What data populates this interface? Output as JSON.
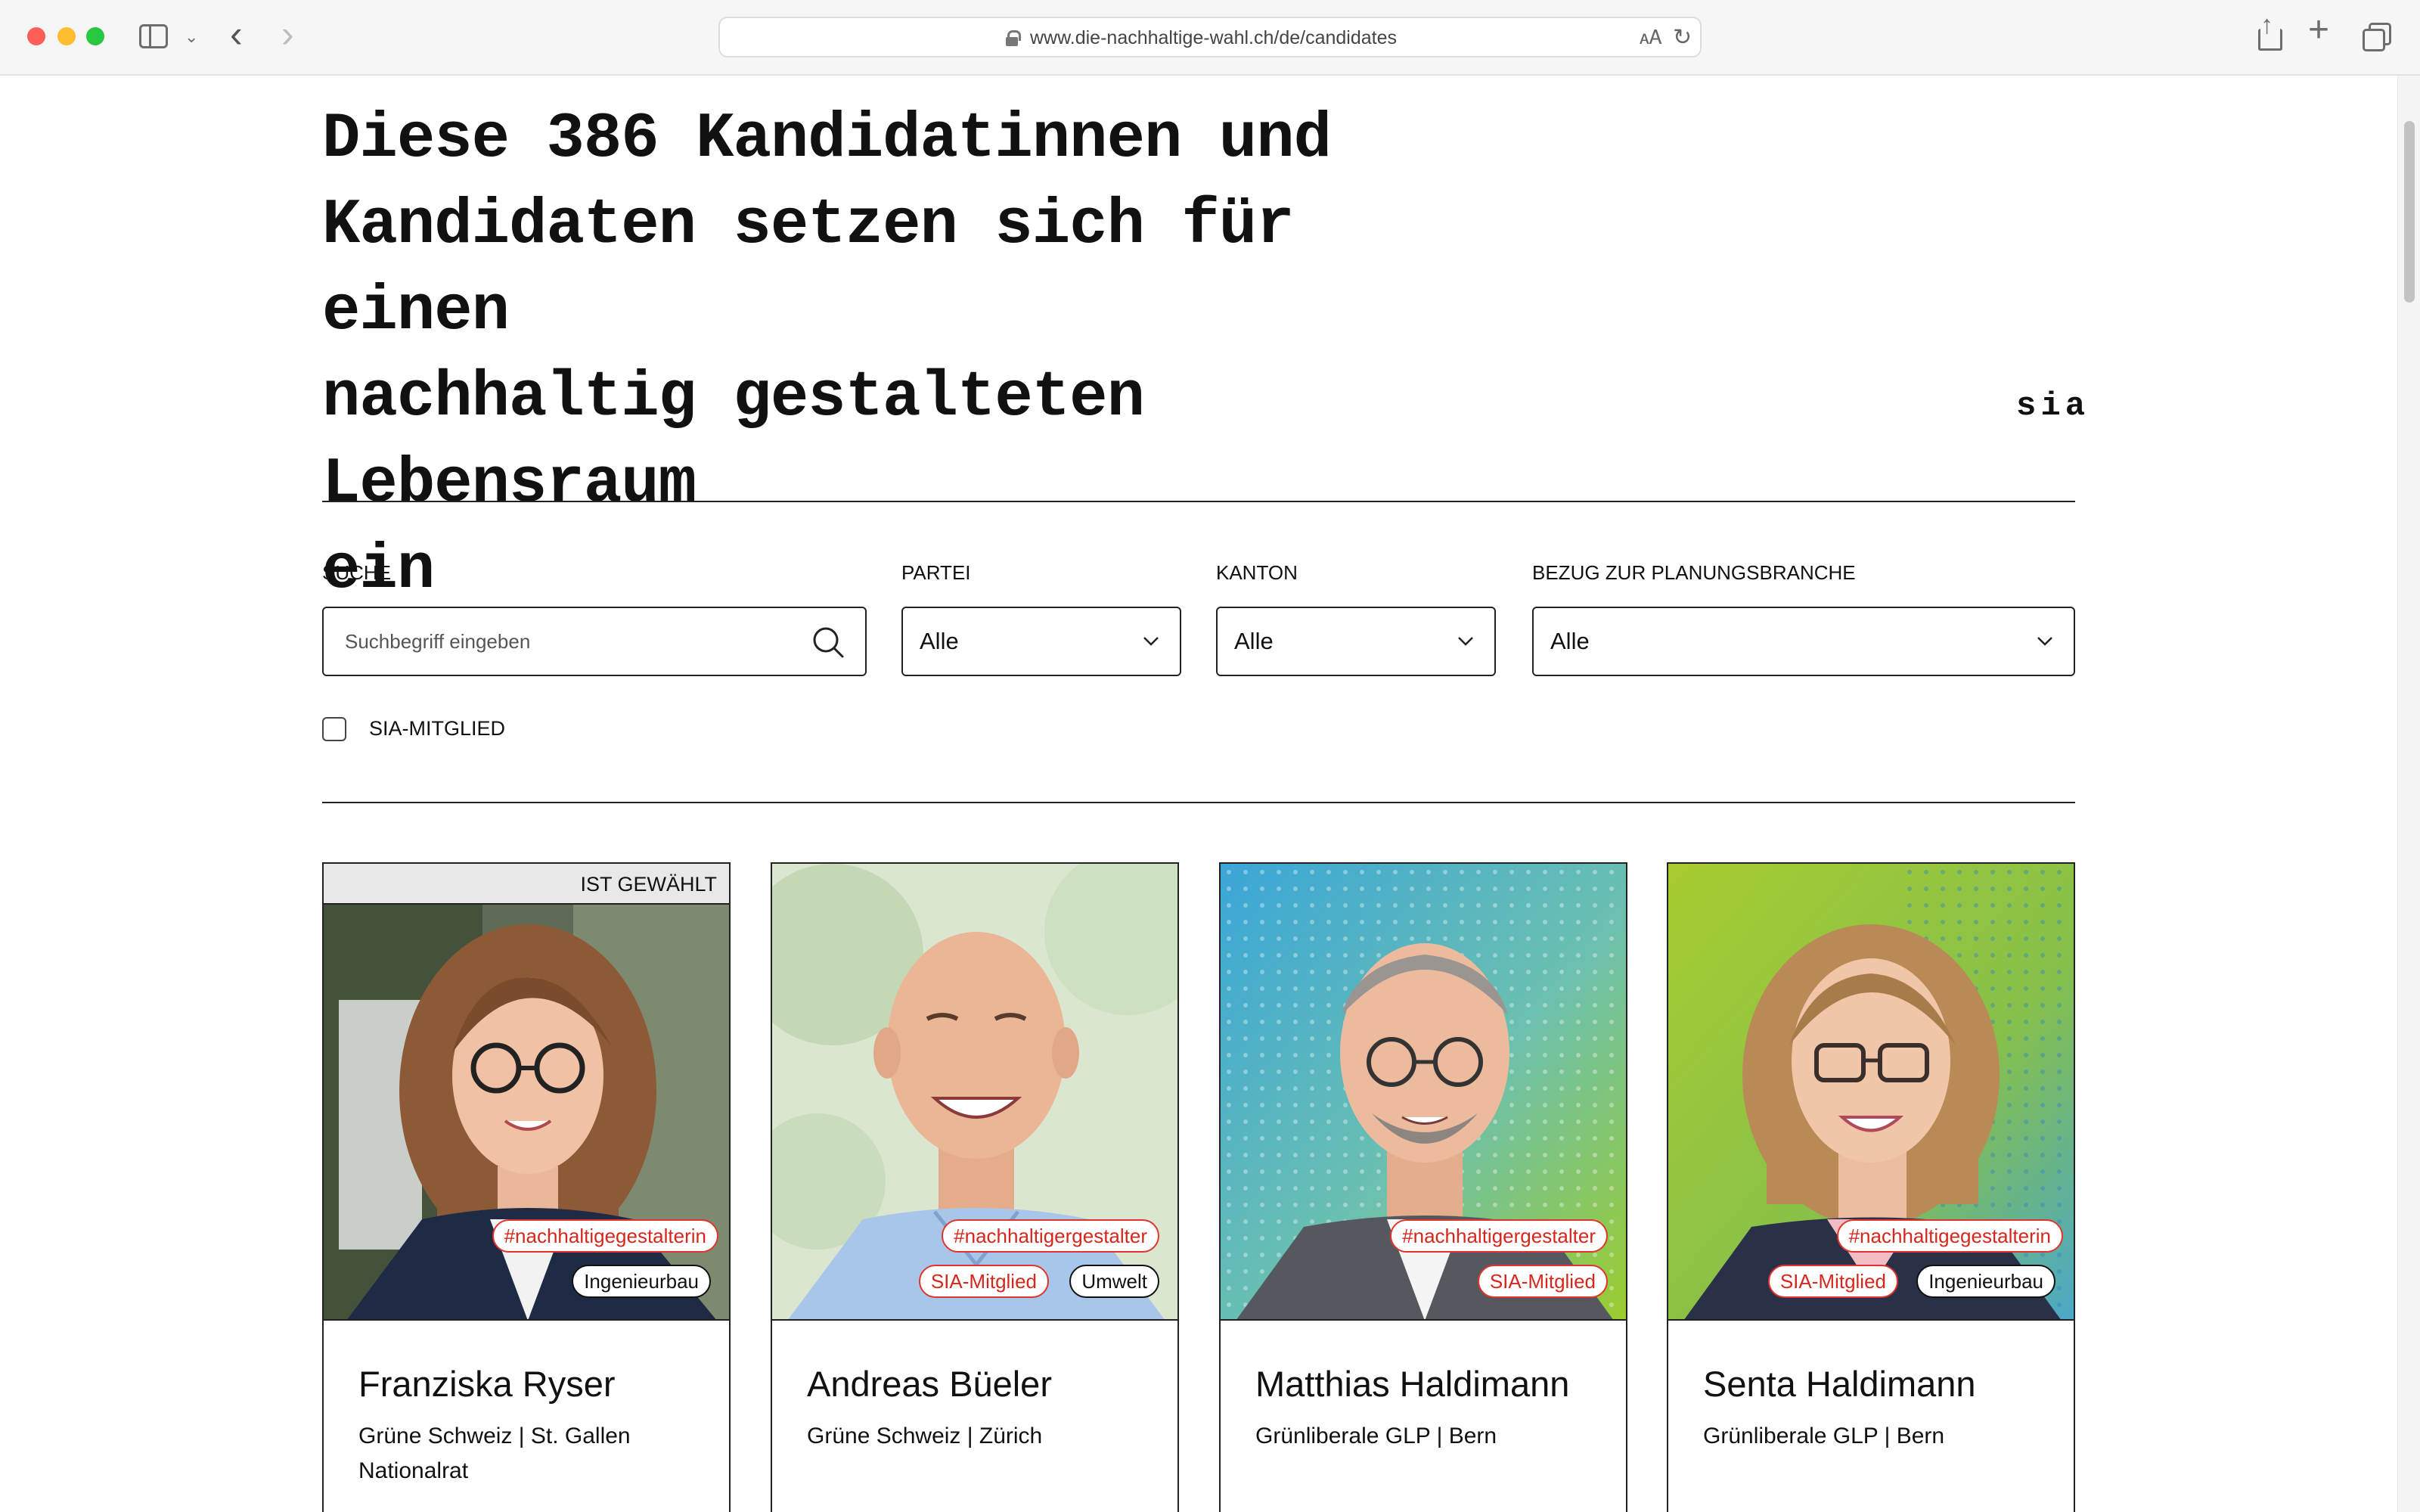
{
  "browser": {
    "url": "www.die-nachhaltige-wahl.ch/de/candidates"
  },
  "page": {
    "headline_lines": [
      "Diese 386 Kandidatinnen und",
      "Kandidaten setzen sich für einen",
      "nachhaltig gestalteten Lebensraum",
      "ein"
    ],
    "logo": "sia"
  },
  "filters": {
    "search": {
      "label": "SUCHE",
      "placeholder": "Suchbegriff eingeben",
      "value": ""
    },
    "partei": {
      "label": "PARTEI",
      "value": "Alle"
    },
    "kanton": {
      "label": "KANTON",
      "value": "Alle"
    },
    "bezug": {
      "label": "BEZUG ZUR PLANUNGSBRANCHE",
      "value": "Alle"
    },
    "sia_member": {
      "label": "SIA-MITGLIED",
      "checked": false
    }
  },
  "candidates": [
    {
      "name": "Franziska Ryser",
      "meta": "Grüne Schweiz | St. Gallen",
      "role": "Nationalrat",
      "elected_label": "IST GEWÄHLT",
      "hashtag": "#nachhaltigegestalterin",
      "sia": "",
      "field": "Ingenieurbau",
      "photo_bg": "#6f7b66"
    },
    {
      "name": "Andreas Büeler",
      "meta": "Grüne Schweiz | Zürich",
      "role": "",
      "elected_label": "",
      "hashtag": "#nachhaltigergestalter",
      "sia": "SIA-Mitglied",
      "field": "Umwelt",
      "photo_bg": "#dde8d2"
    },
    {
      "name": "Matthias Haldimann",
      "meta": "Grünliberale GLP | Bern",
      "role": "",
      "elected_label": "",
      "hashtag": "#nachhaltigergestalter",
      "sia": "SIA-Mitglied",
      "field": "",
      "photo_bg": "#7dbb4c"
    },
    {
      "name": "Senta Haldimann",
      "meta": "Grünliberale GLP | Bern",
      "role": "",
      "elected_label": "",
      "hashtag": "#nachhaltigegestalterin",
      "sia": "SIA-Mitglied",
      "field": "Ingenieurbau",
      "photo_bg": "#8fc23a"
    }
  ]
}
